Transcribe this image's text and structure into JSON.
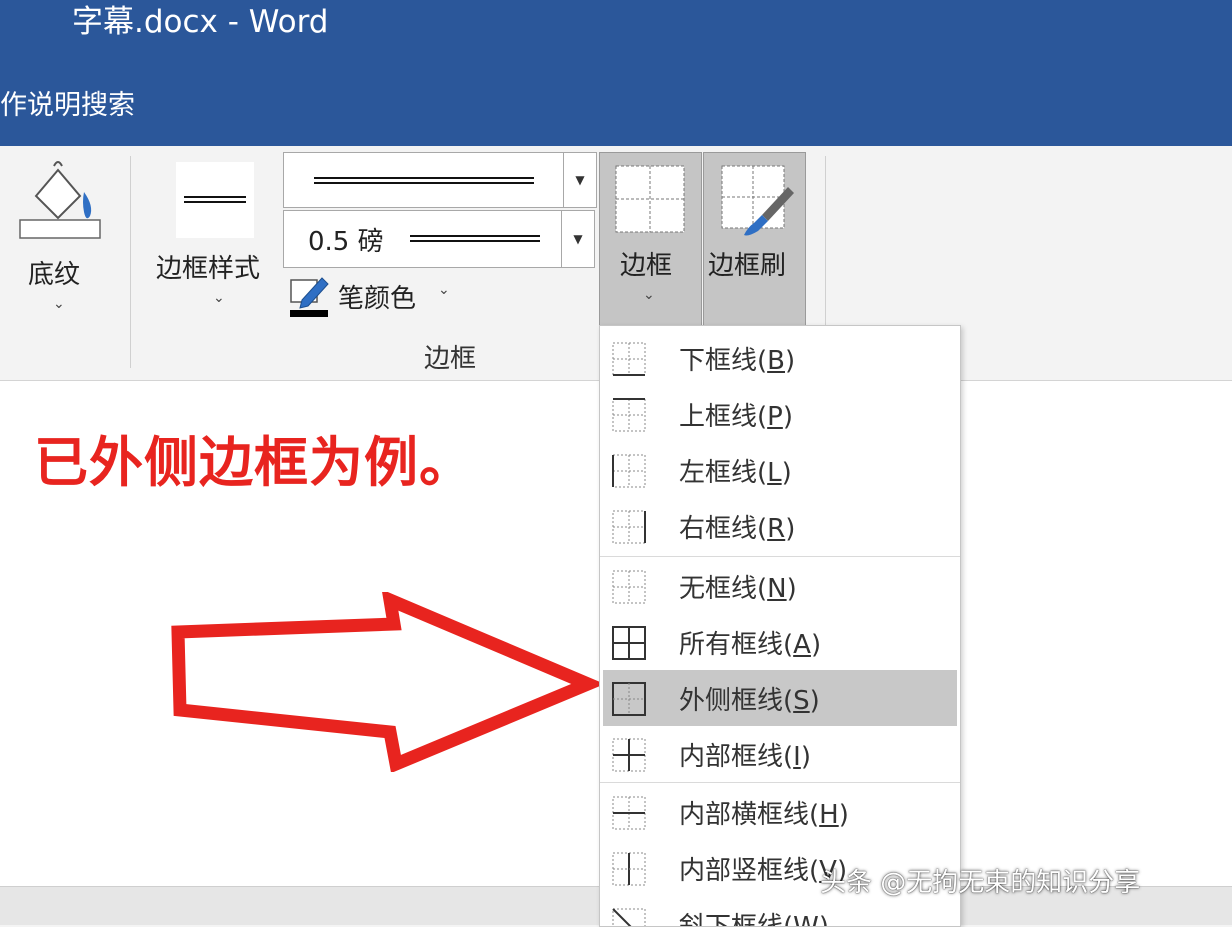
{
  "window": {
    "title": "字幕.docx  -  Word",
    "search_label": "作说明搜索"
  },
  "ribbon": {
    "shading_label": "底纹",
    "border_style_label": "边框样式",
    "pen_weight_value": "0.5 磅",
    "pen_color_label": "笔颜色",
    "group_label": "边框",
    "borders_label": "边框",
    "border_painter_label": "边框刷"
  },
  "document": {
    "note": "已外侧边框为例。",
    "note_color": "#e8241f"
  },
  "menu": {
    "items": [
      {
        "text": "下框线(",
        "key": "B",
        "icon": "bottom-border-icon"
      },
      {
        "text": "上框线(",
        "key": "P",
        "icon": "top-border-icon"
      },
      {
        "text": "左框线(",
        "key": "L",
        "icon": "left-border-icon"
      },
      {
        "text": "右框线(",
        "key": "R",
        "icon": "right-border-icon"
      },
      {
        "text": "无框线(",
        "key": "N",
        "icon": "no-border-icon"
      },
      {
        "text": "所有框线(",
        "key": "A",
        "icon": "all-borders-icon"
      },
      {
        "text": "外侧框线(",
        "key": "S",
        "icon": "outside-borders-icon",
        "highlighted": true
      },
      {
        "text": "内部框线(",
        "key": "I",
        "icon": "inside-borders-icon"
      },
      {
        "text": "内部横框线(",
        "key": "H",
        "icon": "inside-horizontal-border-icon"
      },
      {
        "text": "内部竖框线(",
        "key": "V",
        "icon": "inside-vertical-border-icon"
      },
      {
        "text": "斜下框线(",
        "key": "W",
        "icon": "diagonal-down-border-icon"
      }
    ],
    "close_paren": ")"
  },
  "watermark": "头条 @无拘无束的知识分享",
  "colors": {
    "title_bar": "#2b579a",
    "menu_highlight": "#c8c8c8",
    "arrow": "#e8241f"
  }
}
